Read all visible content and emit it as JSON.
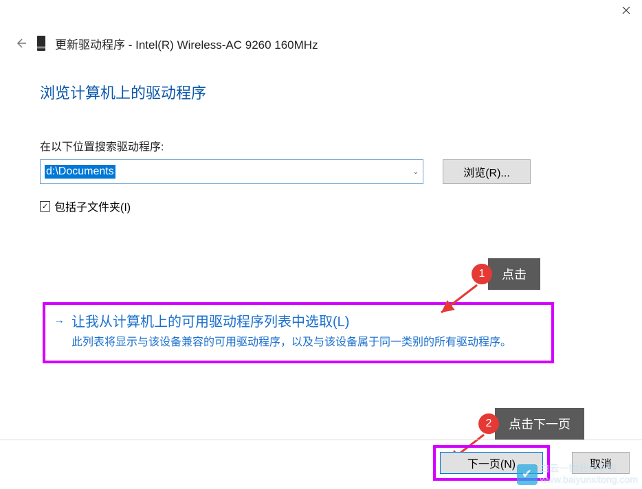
{
  "window": {
    "title_prefix": "更新驱动程序 - ",
    "device_name": "Intel(R) Wireless-AC 9260 160MHz"
  },
  "heading": "浏览计算机上的驱动程序",
  "search": {
    "label": "在以下位置搜索驱动程序:",
    "path": "d:\\Documents",
    "browse_label": "浏览(R)...",
    "include_subfolders_label": "包括子文件夹(I)",
    "include_subfolders_checked": true
  },
  "option": {
    "title": "让我从计算机上的可用驱动程序列表中选取(L)",
    "description": "此列表将显示与该设备兼容的可用驱动程序，以及与该设备属于同一类别的所有驱动程序。"
  },
  "annotations": {
    "a1_num": "1",
    "a1_label": "点击",
    "a2_num": "2",
    "a2_label": "点击下一页"
  },
  "buttons": {
    "next": "下一页(N)",
    "cancel": "取消"
  },
  "watermark": {
    "brand": "白云一键重装系统",
    "url": "www.baiyunxitong.com"
  }
}
